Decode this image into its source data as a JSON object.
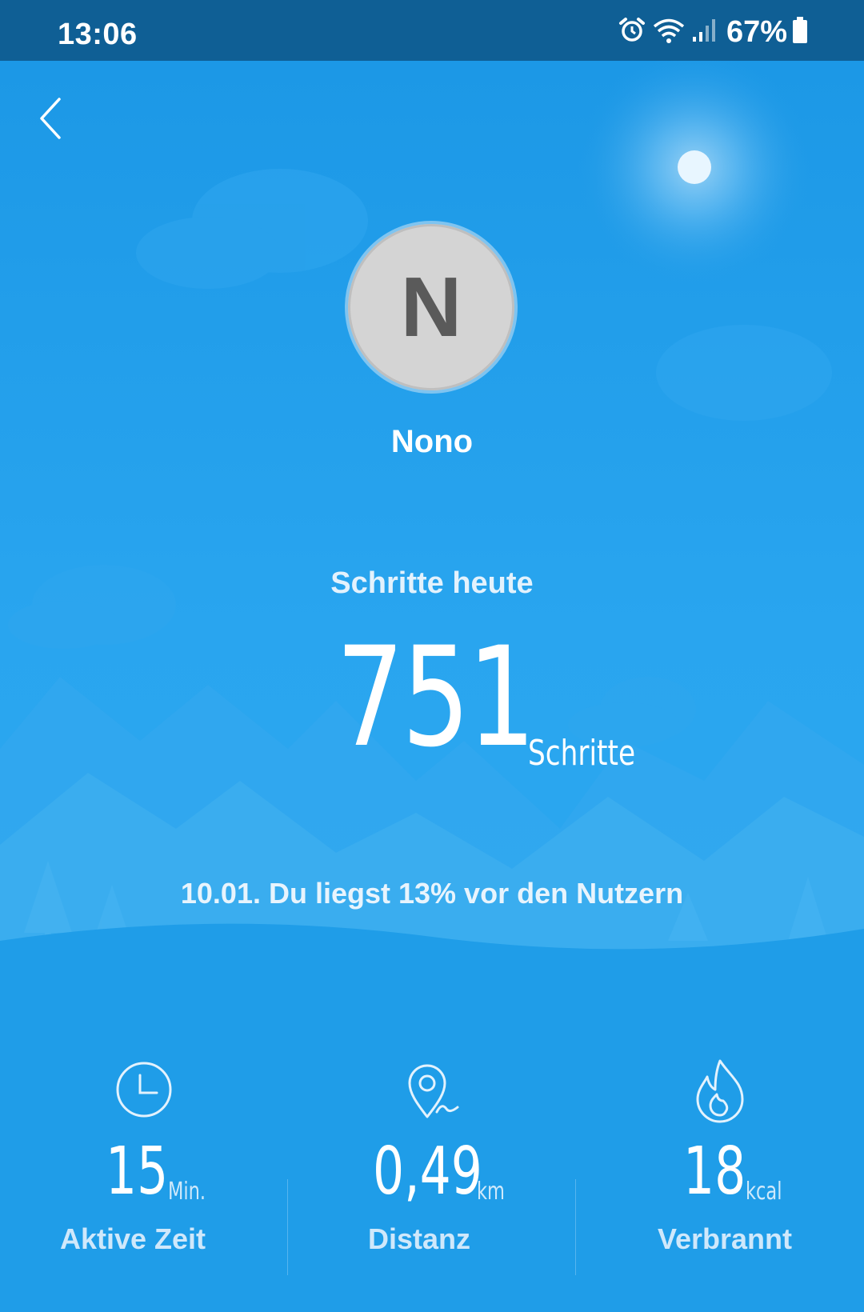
{
  "status_bar": {
    "time": "13:06",
    "battery_percent": "67%",
    "icons": [
      "alarm-icon",
      "wifi-icon",
      "signal-icon",
      "battery-icon"
    ]
  },
  "header": {
    "back_icon": "chevron-left-icon"
  },
  "profile": {
    "avatar_letter": "N",
    "name": "Nono"
  },
  "steps": {
    "title": "Schritte heute",
    "value": "751",
    "unit": "Schritte",
    "comparison": "10.01. Du liegst 13% vor den Nutzern"
  },
  "stats": [
    {
      "icon": "clock-icon",
      "value": "15",
      "unit": "Min.",
      "label": "Aktive Zeit"
    },
    {
      "icon": "location-pin-icon",
      "value": "0,49",
      "unit": "km",
      "label": "Distanz"
    },
    {
      "icon": "flame-icon",
      "value": "18",
      "unit": "kcal",
      "label": "Verbrannt"
    }
  ],
  "colors": {
    "status_bar": "#0f5f95",
    "background": "#1b9be6",
    "text": "#ffffff"
  }
}
